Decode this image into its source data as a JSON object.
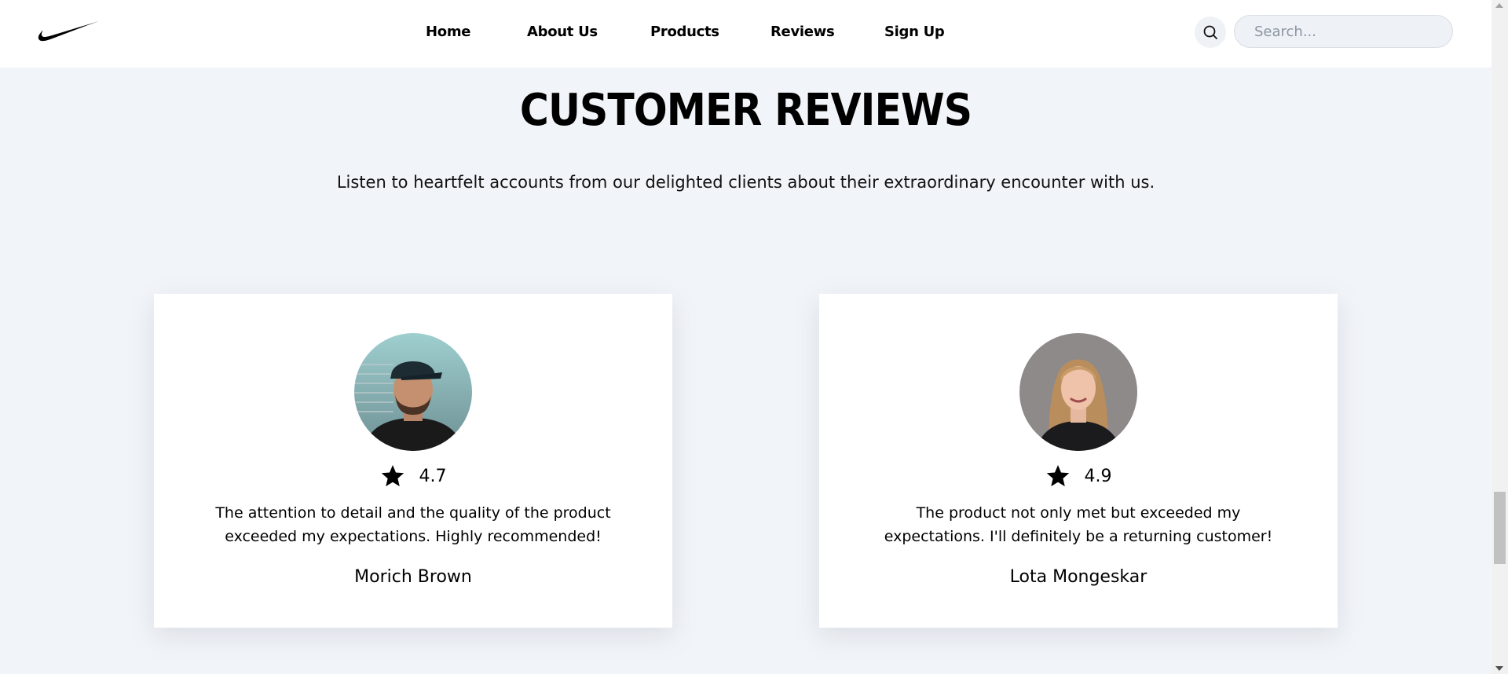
{
  "header": {
    "logo": "nike-swoosh-logo",
    "nav": [
      "Home",
      "About Us",
      "Products",
      "Reviews",
      "Sign Up"
    ],
    "search_icon": "search-icon",
    "search_placeholder": "Search..."
  },
  "section": {
    "title": "CUSTOMER REVIEWS",
    "subtitle": "Listen to heartfelt accounts from our delighted clients about their extraordinary encounter with us."
  },
  "reviews": [
    {
      "rating": "4.7",
      "text": "The attention to detail and the quality of the product exceeded my expectations. Highly recommended!",
      "name": "Morich Brown"
    },
    {
      "rating": "4.9",
      "text": "The product not only met but exceeded my expectations. I'll definitely be a returning customer!",
      "name": "Lota Mongeskar"
    }
  ],
  "colors": {
    "page_bg": "#f1f4f8",
    "card_bg": "#ffffff",
    "text": "#000000"
  }
}
